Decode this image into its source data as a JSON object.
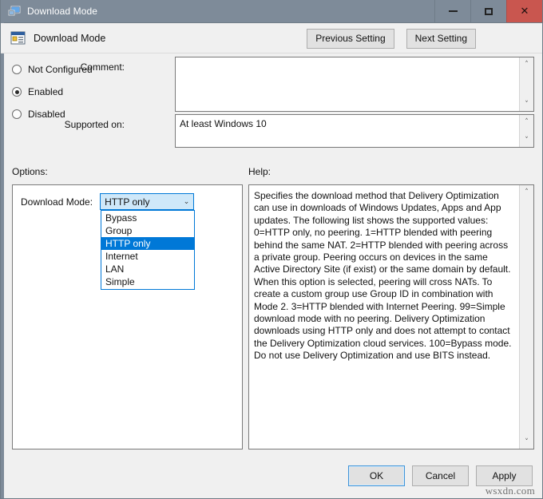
{
  "window": {
    "title": "Download Mode",
    "icon": "computer-monitor-icon",
    "minimize_label": "Minimize",
    "maximize_label": "Maximize",
    "close_label": "✕"
  },
  "header": {
    "title": "Download Mode",
    "icon": "policy-setting-icon",
    "previous_setting": "Previous Setting",
    "next_setting": "Next Setting"
  },
  "state": {
    "options": [
      {
        "label": "Not Configured",
        "checked": false
      },
      {
        "label": "Enabled",
        "checked": true
      },
      {
        "label": "Disabled",
        "checked": false
      }
    ]
  },
  "comment": {
    "label": "Comment:",
    "value": "",
    "placeholder": ""
  },
  "supported_on": {
    "label": "Supported on:",
    "value": "At least Windows 10"
  },
  "sections": {
    "options_label": "Options:",
    "help_label": "Help:"
  },
  "download_mode": {
    "label": "Download Mode:",
    "value": "HTTP only",
    "chevron": "⌄",
    "options": [
      "Bypass",
      "Group",
      "HTTP only",
      "Internet",
      "LAN",
      "Simple"
    ],
    "selected_index": 2
  },
  "help": {
    "text": "Specifies the download method that Delivery Optimization can use in downloads of Windows Updates, Apps and App updates. The following list shows the supported values: 0=HTTP only, no peering. 1=HTTP blended with peering behind the same NAT. 2=HTTP blended with peering across a private group. Peering occurs on devices in the same Active Directory Site (if exist) or the same domain by default. When this option is selected, peering will cross NATs. To create a custom group use Group ID in combination with Mode 2. 3=HTTP blended with Internet Peering. 99=Simple download mode with no peering. Delivery Optimization downloads using HTTP only and does not attempt to contact the Delivery Optimization cloud services. 100=Bypass mode. Do not use Delivery Optimization and use BITS instead."
  },
  "scroll": {
    "up_arrow": "˄",
    "down_arrow": "˅"
  },
  "footer": {
    "ok": "OK",
    "cancel": "Cancel",
    "apply": "Apply",
    "watermark": "wsxdn.com"
  },
  "colors": {
    "titlebar": "#7e8b99",
    "close_button": "#c9564f",
    "selection_blue": "#0078d7",
    "combo_fill": "#cfe8f9",
    "dialog_bg": "#f0f0f0"
  }
}
